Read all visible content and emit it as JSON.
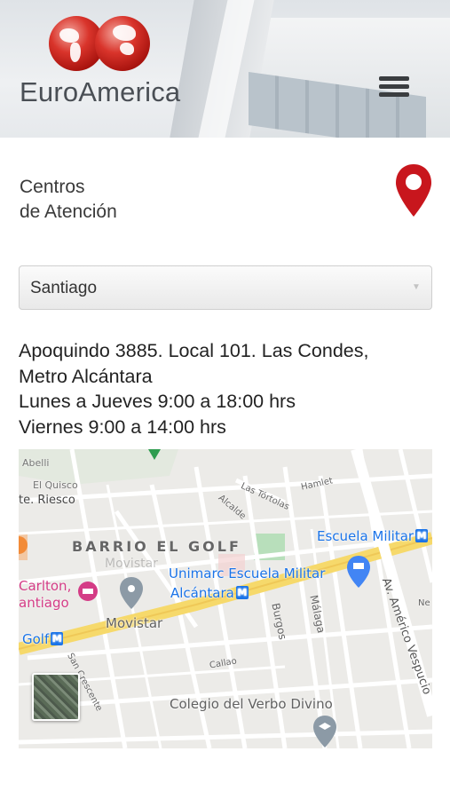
{
  "header": {
    "brand": "EuroAmerica",
    "menu_icon": "hamburger-menu-icon"
  },
  "section": {
    "title_line1": "Centros",
    "title_line2": "de Atención",
    "pin_icon": "location-pin-icon",
    "pin_color": "#c8161d"
  },
  "select": {
    "value": "Santiago"
  },
  "address": {
    "line1": "Apoquindo 3885. Local 101. Las Condes,",
    "line2": "Metro Alcántara",
    "line3": "Lunes a Jueves 9:00 a 18:00 hrs",
    "line4": "Viernes 9:00 a 14:00 hrs"
  },
  "map": {
    "labels": {
      "abelli": "Abelli",
      "el_quisco": "El Quisco",
      "riesco": "te. Riesco",
      "las_tortolas": "Las Tórtolas",
      "alcalde": "Alcalde",
      "hamlet": "Hamlet",
      "escuela_militar": "Escuela Militar",
      "barrio": "BARRIO EL GOLF",
      "movistar_faded": "Movistar",
      "unimarc": "Unimarc Escuela Militar",
      "alcantara": "Alcántara",
      "carlton": "Carlton,",
      "santiago": "antiago",
      "movistar": "Movistar",
      "burgos": "Burgos",
      "malaga": "Málaga",
      "vespucio": "Av. Américo Vespucio",
      "ne": "Ne",
      "golf": "Golf",
      "san_crescente": "San Crescente",
      "callao": "Callao",
      "colegio": "Colegio del Verbo Divino",
      "metro_letter": "M"
    },
    "colors": {
      "road_major": "#f6d96b",
      "park": "#b8dfbb",
      "water_label": "#1a73e8",
      "poi_pink": "#d43c86"
    }
  }
}
